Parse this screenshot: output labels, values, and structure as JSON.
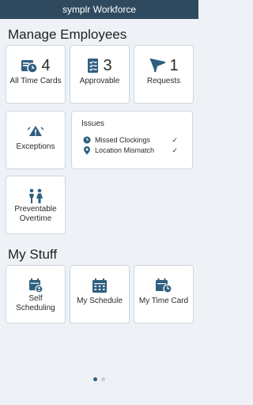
{
  "app": {
    "title": "symplr Workforce"
  },
  "manage": {
    "heading": "Manage Employees",
    "all_time_cards": {
      "label": "All Time Cards",
      "count": "4"
    },
    "approvable": {
      "label": "Approvable",
      "count": "3"
    },
    "requests": {
      "label": "Requests",
      "count": "1"
    },
    "exceptions": {
      "label": "Exceptions"
    },
    "issues": {
      "title": "Issues",
      "items": [
        {
          "label": "Missed Clockings",
          "check": "✓",
          "icon": "clock-icon"
        },
        {
          "label": "Location Mismatch",
          "check": "✓",
          "icon": "location-pin-icon"
        }
      ]
    },
    "preventable_overtime": {
      "line1": "Preventable",
      "line2": "Overtime"
    }
  },
  "my_stuff": {
    "heading": "My Stuff",
    "self_scheduling": {
      "line1": "Self",
      "line2": "Scheduling"
    },
    "my_schedule": {
      "label": "My Schedule"
    },
    "my_time_card": {
      "label": "My Time Card"
    }
  },
  "pager": {
    "pages": 2,
    "active": 1
  },
  "colors": {
    "accent": "#2f5f80",
    "header": "#2f4a5e",
    "background": "#eef2f7"
  }
}
